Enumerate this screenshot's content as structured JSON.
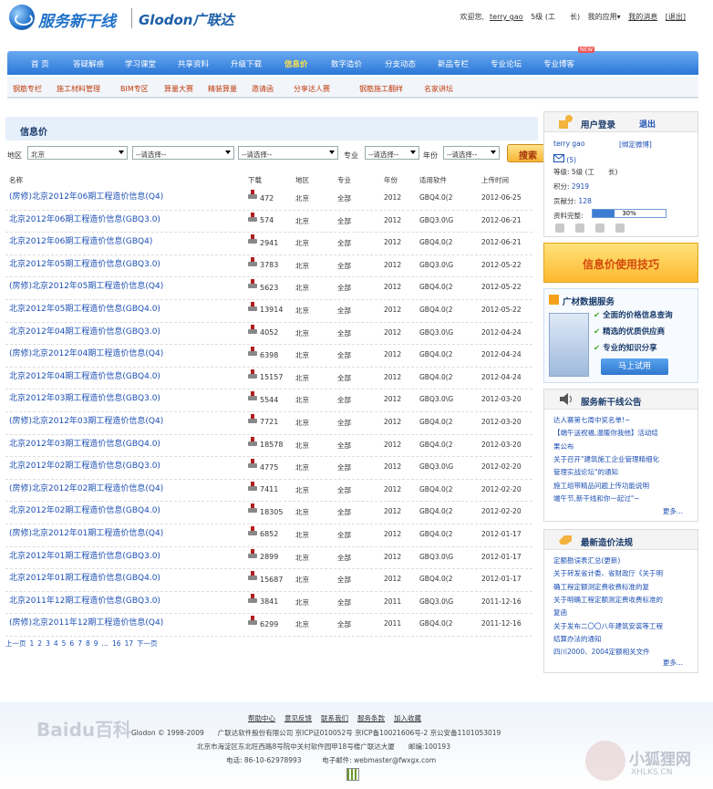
{
  "header": {
    "logo_cn": "服务新干线",
    "logo_en": "Glodon广联达",
    "welcome": "欢迎您,",
    "username": "terry gao",
    "level": "5级 (工　　长)",
    "my_apps": "我的应用▾",
    "messages": "我的消息",
    "logout": "[退出]"
  },
  "nav": {
    "items": [
      "首 页",
      "答疑解惑",
      "学习课堂",
      "共享资料",
      "升级下载",
      "信息价",
      "数字造价",
      "分支动态",
      "新品专栏",
      "专业论坛",
      "专业博客"
    ],
    "badge": "NEW"
  },
  "subnav": {
    "items": [
      "钢筋专栏",
      "施工材料管理",
      "BIM专区",
      "算量大赛",
      "精装算量",
      "邀请函",
      "分享达人赛",
      "钢筋施工翻样",
      "名家讲坛"
    ]
  },
  "main": {
    "title": "信息价",
    "filters": {
      "area_label": "地区",
      "area_value": "北京",
      "select2": "--请选择--",
      "select3": "--请选择--",
      "specialty_label": "专业",
      "specialty_value": "--请选择--",
      "year_label": "年份",
      "year_value": "--请选择--",
      "search": "搜索"
    },
    "columns": [
      "名称",
      "下载",
      "地区",
      "专业",
      "年份",
      "适用软件",
      "上传时间"
    ],
    "rows": [
      {
        "name": "(房修)北京2012年06期工程造价信息(Q4)",
        "downloads": "472",
        "area": "北京",
        "spec": "全部",
        "year": "2012",
        "soft": "GBQ4.0(2",
        "date": "2012-06-25"
      },
      {
        "name": "北京2012年06期工程造价信息(GBQ3.0)",
        "downloads": "574",
        "area": "北京",
        "spec": "全部",
        "year": "2012",
        "soft": "GBQ3.0\\G",
        "date": "2012-06-21"
      },
      {
        "name": "北京2012年06期工程造价信息(GBQ4)",
        "downloads": "2941",
        "area": "北京",
        "spec": "全部",
        "year": "2012",
        "soft": "GBQ4.0(2",
        "date": "2012-06-21"
      },
      {
        "name": "北京2012年05期工程造价信息(GBQ3.0)",
        "downloads": "3783",
        "area": "北京",
        "spec": "全部",
        "year": "2012",
        "soft": "GBQ3.0\\G",
        "date": "2012-05-22"
      },
      {
        "name": "(房修)北京2012年05期工程造价信息(Q4)",
        "downloads": "5623",
        "area": "北京",
        "spec": "全部",
        "year": "2012",
        "soft": "GBQ4.0(2",
        "date": "2012-05-22"
      },
      {
        "name": "北京2012年05期工程造价信息(GBQ4.0)",
        "downloads": "13914",
        "area": "北京",
        "spec": "全部",
        "year": "2012",
        "soft": "GBQ4.0(2",
        "date": "2012-05-22"
      },
      {
        "name": "北京2012年04期工程造价信息(GBQ3.0)",
        "downloads": "4052",
        "area": "北京",
        "spec": "全部",
        "year": "2012",
        "soft": "GBQ3.0\\G",
        "date": "2012-04-24"
      },
      {
        "name": "(房修)北京2012年04期工程造价信息(Q4)",
        "downloads": "6398",
        "area": "北京",
        "spec": "全部",
        "year": "2012",
        "soft": "GBQ4.0(2",
        "date": "2012-04-24"
      },
      {
        "name": "北京2012年04期工程造价信息(GBQ4.0)",
        "downloads": "15157",
        "area": "北京",
        "spec": "全部",
        "year": "2012",
        "soft": "GBQ4.0(2",
        "date": "2012-04-24"
      },
      {
        "name": "北京2012年03期工程造价信息(GBQ3.0)",
        "downloads": "5544",
        "area": "北京",
        "spec": "全部",
        "year": "2012",
        "soft": "GBQ3.0\\G",
        "date": "2012-03-20"
      },
      {
        "name": "(房修)北京2012年03期工程造价信息(Q4)",
        "downloads": "7721",
        "area": "北京",
        "spec": "全部",
        "year": "2012",
        "soft": "GBQ4.0(2",
        "date": "2012-03-20"
      },
      {
        "name": "北京2012年03期工程造价信息(GBQ4.0)",
        "downloads": "18578",
        "area": "北京",
        "spec": "全部",
        "year": "2012",
        "soft": "GBQ4.0(2",
        "date": "2012-03-20"
      },
      {
        "name": "北京2012年02期工程造价信息(GBQ3.0)",
        "downloads": "4775",
        "area": "北京",
        "spec": "全部",
        "year": "2012",
        "soft": "GBQ3.0\\G",
        "date": "2012-02-20"
      },
      {
        "name": "(房修)北京2012年02期工程造价信息(Q4)",
        "downloads": "7411",
        "area": "北京",
        "spec": "全部",
        "year": "2012",
        "soft": "GBQ4.0(2",
        "date": "2012-02-20"
      },
      {
        "name": "北京2012年02期工程造价信息(GBQ4.0)",
        "downloads": "18305",
        "area": "北京",
        "spec": "全部",
        "year": "2012",
        "soft": "GBQ4.0(2",
        "date": "2012-02-20"
      },
      {
        "name": "(房修)北京2012年01期工程造价信息(Q4)",
        "downloads": "6852",
        "area": "北京",
        "spec": "全部",
        "year": "2012",
        "soft": "GBQ4.0(2",
        "date": "2012-01-17"
      },
      {
        "name": "北京2012年01期工程造价信息(GBQ3.0)",
        "downloads": "2899",
        "area": "北京",
        "spec": "全部",
        "year": "2012",
        "soft": "GBQ3.0\\G",
        "date": "2012-01-17"
      },
      {
        "name": "北京2012年01期工程造价信息(GBQ4.0)",
        "downloads": "15687",
        "area": "北京",
        "spec": "全部",
        "year": "2012",
        "soft": "GBQ4.0(2",
        "date": "2012-01-17"
      },
      {
        "name": "北京2011年12期工程造价信息(GBQ3.0)",
        "downloads": "3841",
        "area": "北京",
        "spec": "全部",
        "year": "2011",
        "soft": "GBQ3.0\\G",
        "date": "2011-12-16"
      },
      {
        "name": "(房修)北京2011年12期工程造价信息(Q4)",
        "downloads": "6299",
        "area": "北京",
        "spec": "全部",
        "year": "2011",
        "soft": "GBQ4.0(2",
        "date": "2011-12-16"
      }
    ],
    "pager": [
      "上一页",
      "1",
      "2",
      "3",
      "4",
      "5",
      "6",
      "7",
      "8",
      "9",
      "…",
      "16",
      "17",
      "下一页"
    ]
  },
  "sidebar": {
    "login": {
      "title": "用户登录",
      "logout": "退出",
      "username": "terry gao",
      "bind": "[绑定微博]",
      "mail_count": "(5)",
      "level_label": "等级:",
      "level_value": "5级 (工　　长)",
      "points_label": "积分:",
      "points_value": "2919",
      "contrib_label": "贡献分:",
      "contrib_value": "128",
      "complete_label": "资料完整:",
      "complete_pct": 30,
      "complete_text": "30%"
    },
    "tip_banner": "信息价使用技巧",
    "ad": {
      "title": "广材数据服务",
      "items": [
        "全面的价格信息查询",
        "精选的优质供应商",
        "专业的知识分享"
      ],
      "button": "马上试用"
    },
    "notice": {
      "title": "服务新干线公告",
      "items": [
        "达人赛第七周中奖名单!~",
        "【端午送祝福,温暖你我他】活动结",
        "果公布",
        "关于召开\"建筑施工企业管理精细化",
        "管理实战论坛\"的通知",
        "施工组带精品问题上传功能说明",
        "端午节,新干线和你一起过\"~"
      ],
      "more": "更多..."
    },
    "law": {
      "title": "最新造价法规",
      "items": [
        "定额勘误表汇总(更新)",
        "关于转发省计委、省财政厅《关于明",
        "确工程定额测定费收费标准的复",
        "关于明确工程定额测定费收费标准的",
        "复函",
        "关于发布二〇〇八年建筑安装等工程",
        "结算办法的通知",
        "四川2000、2004定额相关文件"
      ],
      "more": "更多..."
    }
  },
  "footer": {
    "links": [
      "帮助中心",
      "意见反馈",
      "联系我们",
      "服务条款",
      "加入收藏"
    ],
    "line1": "Glodon © 1998-2009　　广联达软件股份有限公司 京ICP证010052号 京ICP备10021606号-2 京公安备1101053019",
    "line2": "北京市海淀区东北旺西路8号院中关村软件园甲18号楼广联达大厦　　邮编:100193",
    "line3": "电话: 86-10-62978993　　　电子邮件: webmaster@fwxgx.com"
  },
  "watermarks": {
    "left": "Baidu百科",
    "right": "小狐狸网",
    "right_sub": "XHLKS.CN"
  }
}
